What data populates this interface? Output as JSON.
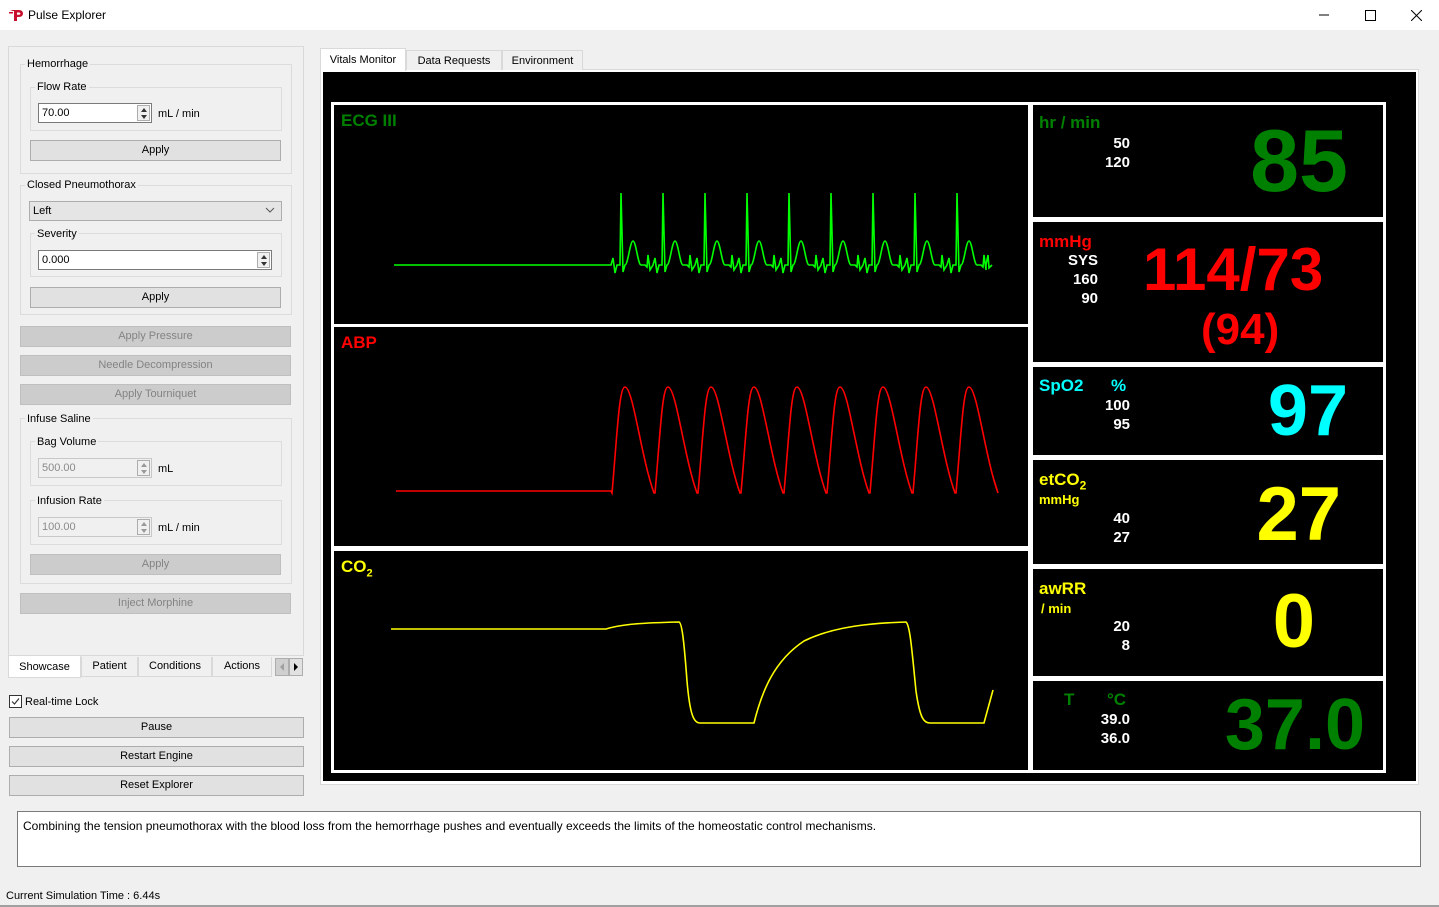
{
  "window": {
    "title": "Pulse Explorer",
    "icon": "pulse-logo-icon",
    "controls": [
      "minimize-icon",
      "maximize-icon",
      "close-icon"
    ]
  },
  "left_panel": {
    "hemorrhage": {
      "title": "Hemorrhage",
      "flow_rate": {
        "label": "Flow Rate",
        "value": "70.00",
        "unit": "mL / min"
      },
      "apply_label": "Apply"
    },
    "pneumothorax": {
      "title": "Closed Pneumothorax",
      "side": "Left",
      "severity": {
        "label": "Severity",
        "value": "0.000"
      },
      "apply_label": "Apply"
    },
    "apply_pressure_label": "Apply Pressure",
    "needle_decompression_label": "Needle Decompression",
    "apply_tourniquet_label": "Apply Tourniquet",
    "saline": {
      "title": "Infuse Saline",
      "bag_volume": {
        "label": "Bag Volume",
        "value": "500.00",
        "unit": "mL"
      },
      "infusion_rate": {
        "label": "Infusion Rate",
        "value": "100.00",
        "unit": "mL / min"
      },
      "apply_label": "Apply"
    },
    "inject_morphine_label": "Inject Morphine",
    "tabs": [
      {
        "label": "Showcase",
        "active": true
      },
      {
        "label": "Patient",
        "active": false
      },
      {
        "label": "Conditions",
        "active": false
      },
      {
        "label": "Actions",
        "active": false
      }
    ],
    "realtime_lock": {
      "label": "Real-time Lock",
      "checked": true
    },
    "pause_label": "Pause",
    "restart_label": "Restart Engine",
    "reset_label": "Reset Explorer"
  },
  "main": {
    "tabs": [
      {
        "label": "Vitals Monitor",
        "active": true
      },
      {
        "label": "Data Requests",
        "active": false
      },
      {
        "label": "Environment",
        "active": false
      }
    ],
    "waveforms": {
      "ecg": {
        "title": "ECG III",
        "color": "#00ff00",
        "title_color": "#008000"
      },
      "abp": {
        "title": "ABP",
        "color": "#ff0000",
        "title_color": "#ff0000"
      },
      "co2": {
        "title": "CO",
        "title_sub": "2",
        "color": "#ffff00",
        "title_color": "#ffff00"
      }
    },
    "vitals": {
      "hr": {
        "label": "hr / min",
        "high": "50",
        "low": "120",
        "value": "85",
        "color": "#008000"
      },
      "bp": {
        "label": "mmHg",
        "sub": "SYS",
        "high": "160",
        "low": "90",
        "value": "114/73",
        "mean": "(94)",
        "color": "#ff0000"
      },
      "spo2": {
        "label": "SpO2",
        "unit": "%",
        "high": "100",
        "low": "95",
        "value": "97",
        "color": "#00ffff"
      },
      "etco2": {
        "label": "etCO",
        "label_sub": "2",
        "unit": "mmHg",
        "high": "40",
        "low": "27",
        "value": "27",
        "color": "#ffff00"
      },
      "awrr": {
        "label": "awRR",
        "unit": "/ min",
        "high": "20",
        "low": "8",
        "value": "0",
        "color": "#ffff00"
      },
      "temp": {
        "label": "T",
        "unit": "°C",
        "high": "39.0",
        "low": "36.0",
        "value": "37.0",
        "color": "#008000"
      }
    }
  },
  "description": "Combining the tension pneumothorax with the blood loss from the hemorrhage pushes and eventually exceeds the limits of the homeostatic control mechanisms.",
  "status": "Current Simulation Time : 6.44s"
}
